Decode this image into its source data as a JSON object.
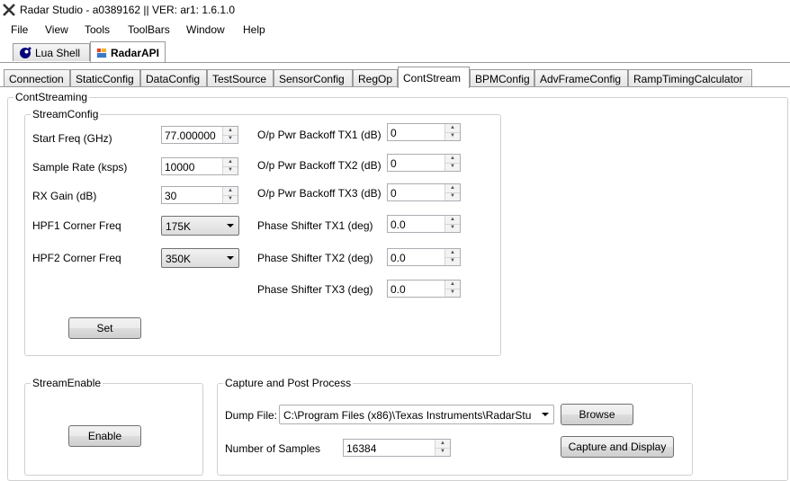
{
  "window": {
    "title": "Radar Studio - a0389162 || VER: ar1: 1.6.1.0",
    "logo_icon": "x-logo-icon"
  },
  "menu": [
    "File",
    "View",
    "Tools",
    "ToolBars",
    "Window",
    "Help"
  ],
  "outer_tabs": [
    {
      "label": "Lua Shell",
      "icon": "lua-icon"
    },
    {
      "label": "RadarAPI",
      "icon": "radar-api-icon"
    }
  ],
  "inner_tabs": [
    "Connection",
    "StaticConfig",
    "DataConfig",
    "TestSource",
    "SensorConfig",
    "RegOp",
    "ContStream",
    "BPMConfig",
    "AdvFrameConfig",
    "RampTimingCalculator"
  ],
  "cont_streaming": {
    "title": "ContStreaming",
    "stream_config": {
      "title": "StreamConfig",
      "start_freq": {
        "label": "Start Freq (GHz)",
        "value": "77.000000"
      },
      "sample_rate": {
        "label": "Sample Rate (ksps)",
        "value": "10000"
      },
      "rx_gain": {
        "label": "RX Gain (dB)",
        "value": "30"
      },
      "hpf1": {
        "label": "HPF1 Corner Freq",
        "value": "175K"
      },
      "hpf2": {
        "label": "HPF2 Corner Freq",
        "value": "350K"
      },
      "backoff_tx1": {
        "label": "O/p Pwr Backoff TX1 (dB)",
        "value": "0"
      },
      "backoff_tx2": {
        "label": "O/p Pwr Backoff TX2 (dB)",
        "value": "0"
      },
      "backoff_tx3": {
        "label": "O/p Pwr Backoff TX3 (dB)",
        "value": "0"
      },
      "phase_tx1": {
        "label": "Phase Shifter TX1 (deg)",
        "value": "0.0"
      },
      "phase_tx2": {
        "label": "Phase Shifter TX2 (deg)",
        "value": "0.0"
      },
      "phase_tx3": {
        "label": "Phase Shifter TX3 (deg)",
        "value": "0.0"
      },
      "set_button": "Set"
    },
    "stream_enable": {
      "title": "StreamEnable",
      "enable_button": "Enable"
    },
    "capture": {
      "title": "Capture and Post Process",
      "dump_file_label": "Dump File:",
      "dump_file_value": "C:\\Program Files (x86)\\Texas Instruments\\RadarStu",
      "browse_button": "Browse",
      "num_samples_label": "Number of Samples",
      "num_samples_value": "16384",
      "capture_button": "Capture and Display"
    }
  }
}
